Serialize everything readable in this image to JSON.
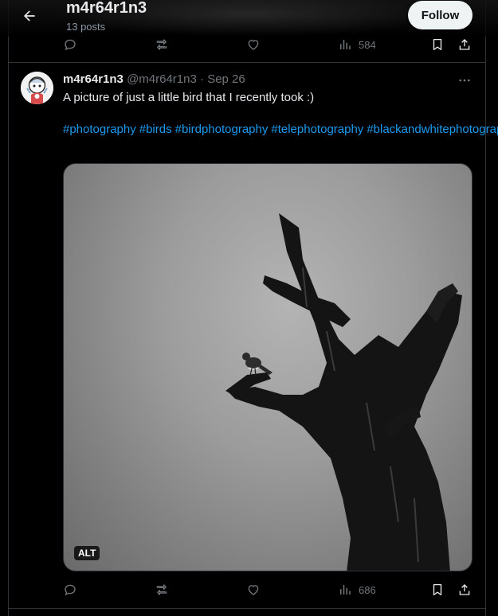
{
  "header": {
    "title": "m4r64r1n3",
    "posts_count": "13 posts",
    "follow_label": "Follow"
  },
  "previous_post": {
    "views": "584"
  },
  "tweet": {
    "display_name": "m4r64r1n3",
    "handle": "@m4r64r1n3",
    "separator": "·",
    "date": "Sep 26",
    "text": "A picture of just a little bird that I recently took :)",
    "hashtags": [
      "#photography",
      "#birds",
      "#birdphotography",
      "#telephotography",
      "#blackandwhitephotography"
    ],
    "media_badge": "ALT",
    "views": "686"
  },
  "icons": {
    "back": "arrow-left-icon",
    "reply": "reply-icon",
    "retweet": "retweet-icon",
    "like": "heart-icon",
    "views": "views-chart-icon",
    "bookmark": "bookmark-icon",
    "share": "share-icon",
    "more": "more-dots-icon"
  },
  "colors": {
    "background": "#000000",
    "text": "#e7e9ea",
    "secondary": "#71767b",
    "link": "#1d9bf0",
    "border": "#2f3336",
    "follow_bg": "#eff3f4"
  }
}
